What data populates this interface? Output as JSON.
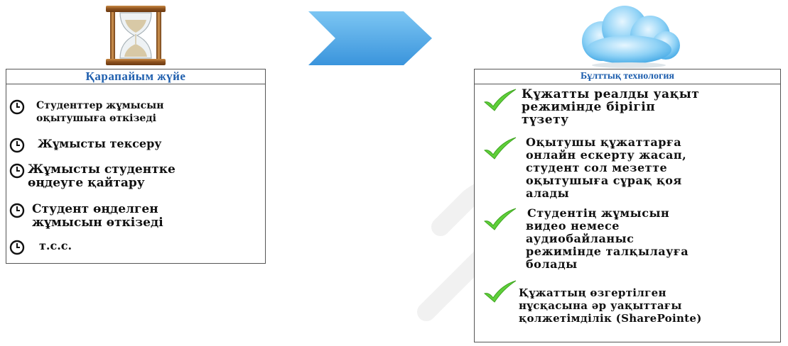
{
  "left_panel": {
    "title": "Қарапайым жүйе",
    "items": [
      {
        "line1": "Студенттер жұмысын",
        "line2": "оқытушыға өткізеді"
      },
      {
        "line1": "Жұмысты тексеру",
        "line2": ""
      },
      {
        "line1": "Жұмысты студентке",
        "line2": "өңдеуге қайтару"
      },
      {
        "line1": "Студент өңделген",
        "line2": "жұмысын өткізеді"
      },
      {
        "line1": "т.с.с.",
        "line2": ""
      }
    ]
  },
  "right_panel": {
    "title": "Бұлттық технология",
    "items": [
      {
        "lines": [
          "Құжатты реалды уақыт",
          "режимінде бірігіп",
          "түзету"
        ]
      },
      {
        "lines": [
          "Оқытушы құжаттарға",
          "онлайн ескерту жасап,",
          "студент сол мезетте",
          "оқытушыға сұрақ қоя",
          "алады"
        ]
      },
      {
        "lines": [
          "Студентің жұмысын",
          "видео немесе",
          "аудиобайланыс",
          "режимінде талқылауға",
          "болады"
        ]
      },
      {
        "lines": [
          "Құжаттың өзгертілген",
          "нұсқасына әр уақыттағы",
          "қолжетімділік (SharePointe)"
        ]
      }
    ]
  },
  "colors": {
    "title_blue": "#1f5fae",
    "check_green": "#5fcf3a",
    "arrow_blue": "#4fa9e8",
    "cloud_blue": "#6fc3f2"
  },
  "icons": {
    "top_left": "hourglass-icon",
    "top_middle": "chevron-arrow-icon",
    "top_right": "cloud-icon",
    "bullet_left": "clock-icon",
    "bullet_right": "checkmark-icon"
  }
}
